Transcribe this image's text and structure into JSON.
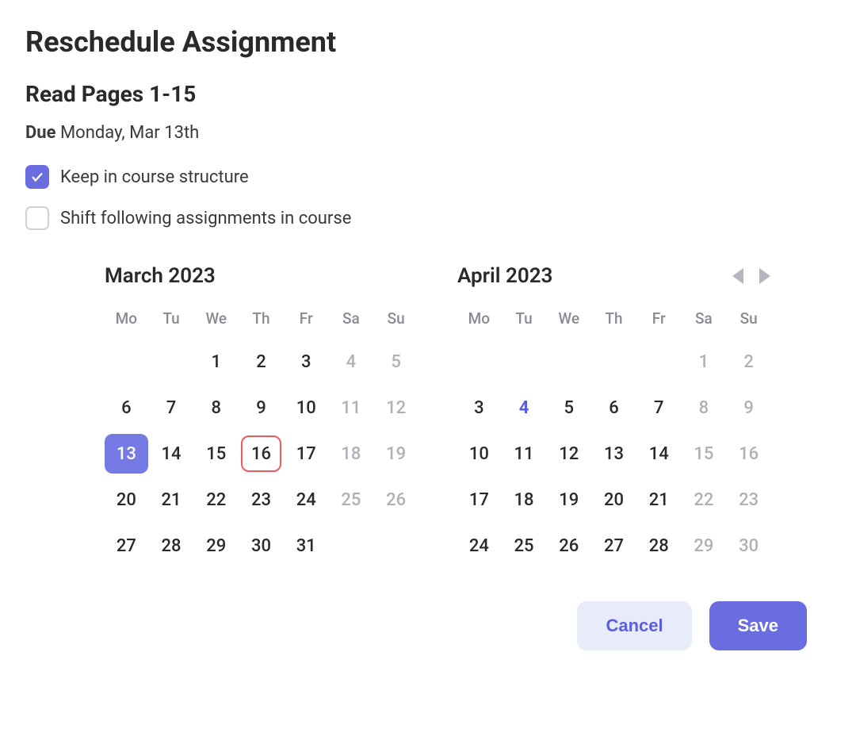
{
  "header": {
    "title": "Reschedule Assignment"
  },
  "assignment": {
    "name": "Read Pages 1-15",
    "due_label": "Due",
    "due_text": "Monday, Mar 13th"
  },
  "options": {
    "keep_structure": {
      "label": "Keep in course structure",
      "checked": true
    },
    "shift_following": {
      "label": "Shift following assignments in course",
      "checked": false
    }
  },
  "calendars": {
    "weekdays": [
      "Mo",
      "Tu",
      "We",
      "Th",
      "Fr",
      "Sa",
      "Su"
    ],
    "months": [
      {
        "label": "March 2023",
        "show_nav": false,
        "weeks": [
          [
            {
              "d": ""
            },
            {
              "d": ""
            },
            {
              "d": "1"
            },
            {
              "d": "2"
            },
            {
              "d": "3"
            },
            {
              "d": "4",
              "muted": true
            },
            {
              "d": "5",
              "muted": true
            }
          ],
          [
            {
              "d": "6"
            },
            {
              "d": "7"
            },
            {
              "d": "8"
            },
            {
              "d": "9"
            },
            {
              "d": "10"
            },
            {
              "d": "11",
              "muted": true
            },
            {
              "d": "12",
              "muted": true
            }
          ],
          [
            {
              "d": "13",
              "selected": true
            },
            {
              "d": "14"
            },
            {
              "d": "15"
            },
            {
              "d": "16",
              "outlined": true
            },
            {
              "d": "17"
            },
            {
              "d": "18",
              "muted": true
            },
            {
              "d": "19",
              "muted": true
            }
          ],
          [
            {
              "d": "20"
            },
            {
              "d": "21"
            },
            {
              "d": "22"
            },
            {
              "d": "23"
            },
            {
              "d": "24"
            },
            {
              "d": "25",
              "muted": true
            },
            {
              "d": "26",
              "muted": true
            }
          ],
          [
            {
              "d": "27"
            },
            {
              "d": "28"
            },
            {
              "d": "29"
            },
            {
              "d": "30"
            },
            {
              "d": "31"
            },
            {
              "d": ""
            },
            {
              "d": ""
            }
          ]
        ]
      },
      {
        "label": "April 2023",
        "show_nav": true,
        "weeks": [
          [
            {
              "d": ""
            },
            {
              "d": ""
            },
            {
              "d": ""
            },
            {
              "d": ""
            },
            {
              "d": ""
            },
            {
              "d": "1",
              "muted": true
            },
            {
              "d": "2",
              "muted": true
            }
          ],
          [
            {
              "d": "3"
            },
            {
              "d": "4",
              "today": true
            },
            {
              "d": "5"
            },
            {
              "d": "6"
            },
            {
              "d": "7"
            },
            {
              "d": "8",
              "muted": true
            },
            {
              "d": "9",
              "muted": true
            }
          ],
          [
            {
              "d": "10"
            },
            {
              "d": "11"
            },
            {
              "d": "12"
            },
            {
              "d": "13"
            },
            {
              "d": "14"
            },
            {
              "d": "15",
              "muted": true
            },
            {
              "d": "16",
              "muted": true
            }
          ],
          [
            {
              "d": "17"
            },
            {
              "d": "18"
            },
            {
              "d": "19"
            },
            {
              "d": "20"
            },
            {
              "d": "21"
            },
            {
              "d": "22",
              "muted": true
            },
            {
              "d": "23",
              "muted": true
            }
          ],
          [
            {
              "d": "24"
            },
            {
              "d": "25"
            },
            {
              "d": "26"
            },
            {
              "d": "27"
            },
            {
              "d": "28"
            },
            {
              "d": "29",
              "muted": true
            },
            {
              "d": "30",
              "muted": true
            }
          ]
        ]
      }
    ]
  },
  "actions": {
    "cancel": "Cancel",
    "save": "Save"
  }
}
